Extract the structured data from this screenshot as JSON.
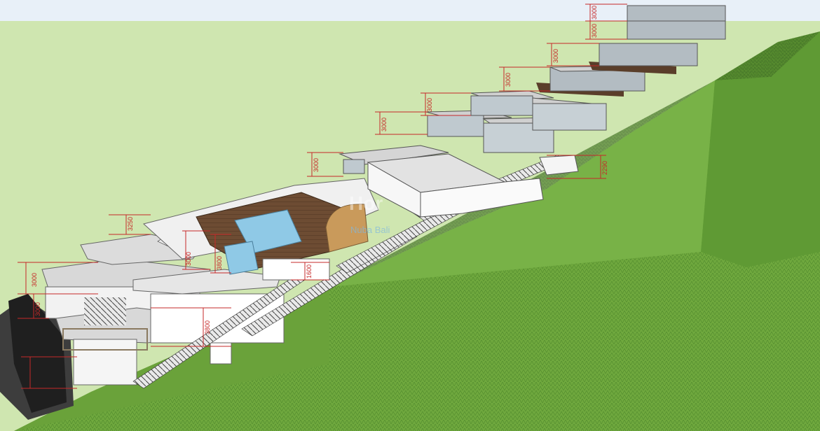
{
  "dimensions": [
    {
      "id": "d1",
      "label": "3000"
    },
    {
      "id": "d2",
      "label": "3000"
    },
    {
      "id": "d3",
      "label": "3000"
    },
    {
      "id": "d4",
      "label": "3000"
    },
    {
      "id": "d5",
      "label": "3000"
    },
    {
      "id": "d6",
      "label": "3000"
    },
    {
      "id": "d7",
      "label": "3000"
    },
    {
      "id": "d8",
      "label": "2290"
    },
    {
      "id": "d9",
      "label": "3000"
    },
    {
      "id": "d10",
      "label": "3250"
    },
    {
      "id": "d11",
      "label": "3800"
    },
    {
      "id": "d12",
      "label": "1600"
    },
    {
      "id": "d13",
      "label": "3000"
    },
    {
      "id": "d14",
      "label": "3000"
    },
    {
      "id": "d15",
      "label": "3800"
    }
  ],
  "watermark": {
    "brand": "Hor",
    "sub": "Nuba Bali"
  },
  "colors": {
    "sky": "#cfe6b0",
    "terrain_light": "#9ccc65",
    "terrain_dark": "#4f8a2b",
    "building": "#f2f2f2",
    "glass": "#bfc9cf",
    "deck": "#6d4c33",
    "pool": "#8fc9e6",
    "dimension": "#c62828"
  }
}
